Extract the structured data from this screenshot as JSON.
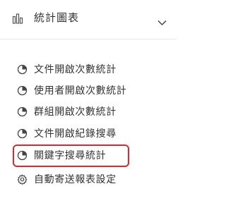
{
  "header": {
    "icon": "bar-chart-icon",
    "title": "統計圖表",
    "chevron_icon": "chevron-down-icon"
  },
  "menu": {
    "items": [
      {
        "label": "文件開啟次數統計",
        "icon": "pie-chart-icon"
      },
      {
        "label": "使用者開啟次數統計",
        "icon": "pie-chart-icon"
      },
      {
        "label": "群組開啟次數統計",
        "icon": "pie-chart-icon"
      },
      {
        "label": "文件開啟紀錄搜尋",
        "icon": "pie-chart-icon"
      },
      {
        "label": "關鍵字搜尋統計",
        "icon": "pie-chart-icon",
        "highlighted": true
      },
      {
        "label": "自動寄送報表設定",
        "icon": "gear-icon"
      }
    ]
  },
  "colors": {
    "text": "#333333",
    "highlight": "#e0272f",
    "divider": "#e6e6e6"
  }
}
